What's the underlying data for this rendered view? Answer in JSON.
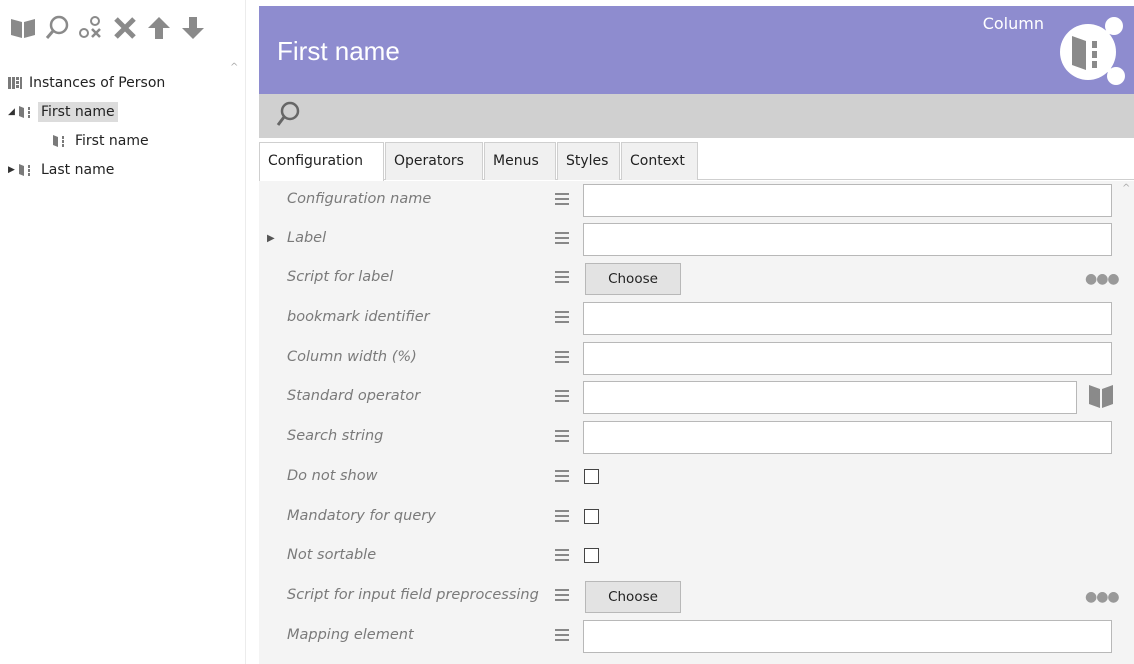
{
  "toolbar": {
    "icons": [
      "open-book-icon",
      "search-icon",
      "link-icon",
      "delete-icon",
      "move-up-icon",
      "move-down-icon"
    ]
  },
  "tree": {
    "root_label": "Instances of Person",
    "items": [
      {
        "label": "First name",
        "expanded": true,
        "selected": true
      },
      {
        "label": "First name",
        "expanded": false,
        "selected": false
      },
      {
        "label": "Last name",
        "expanded": false,
        "selected": false
      }
    ]
  },
  "header": {
    "title": "First name",
    "category": "Column",
    "color": "#8e8ccf"
  },
  "tabs": [
    "Configuration",
    "Operators",
    "Menus",
    "Styles",
    "Context"
  ],
  "form": {
    "rows": [
      {
        "label": "Configuration name",
        "type": "input",
        "value": ""
      },
      {
        "label": "Label",
        "type": "input",
        "value": ""
      },
      {
        "label": "Script for label",
        "type": "choose",
        "button": "Choose"
      },
      {
        "label": "bookmark identifier",
        "type": "input",
        "value": ""
      },
      {
        "label": "Column width (%)",
        "type": "input",
        "value": ""
      },
      {
        "label": "Standard operator",
        "type": "input",
        "value": ""
      },
      {
        "label": "Search string",
        "type": "input",
        "value": ""
      },
      {
        "label": "Do not show",
        "type": "checkbox",
        "checked": false
      },
      {
        "label": "Mandatory for query",
        "type": "checkbox",
        "checked": false
      },
      {
        "label": "Not sortable",
        "type": "checkbox",
        "checked": false
      },
      {
        "label": "Script for input field preprocessing",
        "type": "choose",
        "button": "Choose"
      },
      {
        "label": "Mapping element",
        "type": "input",
        "value": ""
      }
    ],
    "more_glyph": "●●●"
  }
}
